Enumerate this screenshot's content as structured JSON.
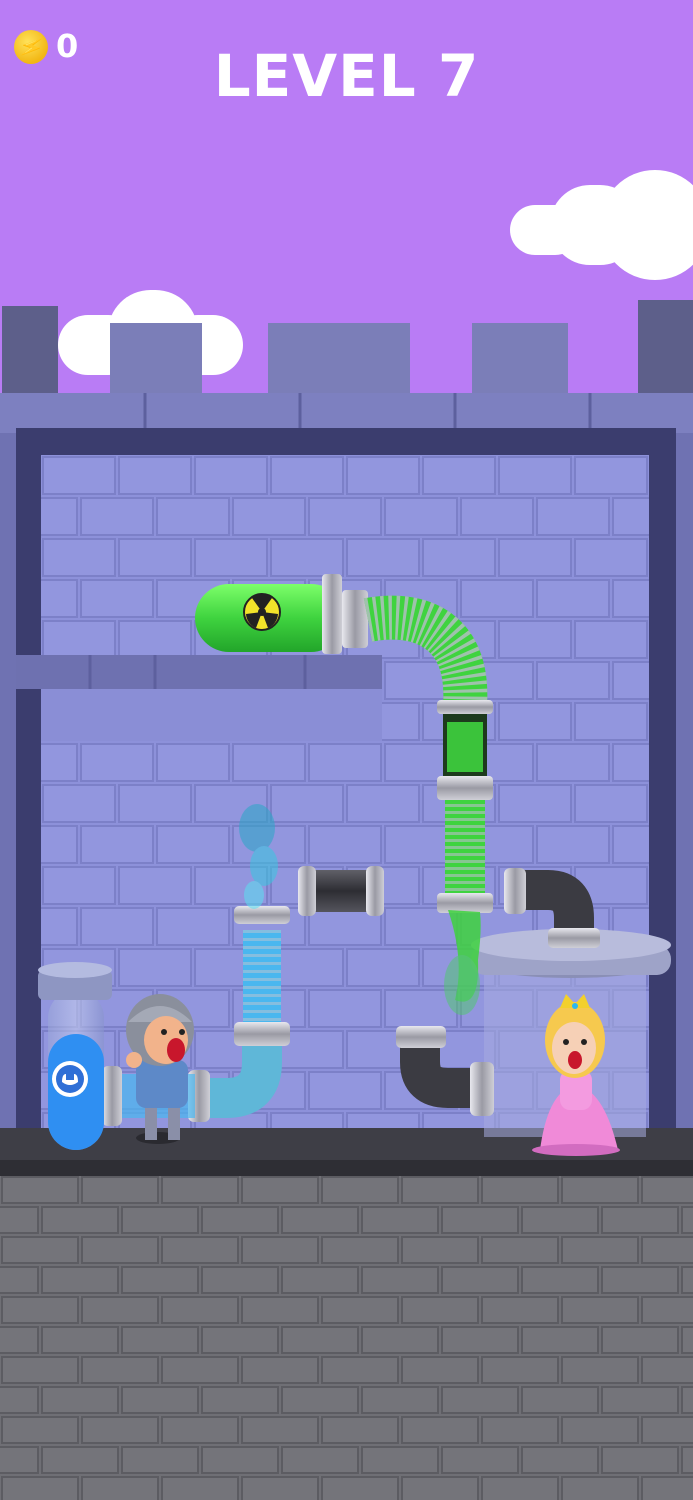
{
  "hud": {
    "coin_icon": "coin-icon",
    "coin_count": "0",
    "level_title": "LEVEL 7"
  },
  "scene": {
    "characters": [
      "knight",
      "princess"
    ],
    "icons": [
      "radiation-icon",
      "strength-icon"
    ],
    "pipes": [
      "toxic-tank",
      "flexible-hose",
      "green-valve",
      "blue-valve",
      "straight-pipe",
      "elbow-pipe-left",
      "elbow-pipe-right"
    ]
  },
  "colors": {
    "sky": "#b97cf5",
    "wall": "#7d7ec9",
    "brick_inner": "#8f93dc",
    "toxic_green": "#3fd33f",
    "water_blue": "#47b8ff",
    "floor": "#4a4a55"
  }
}
